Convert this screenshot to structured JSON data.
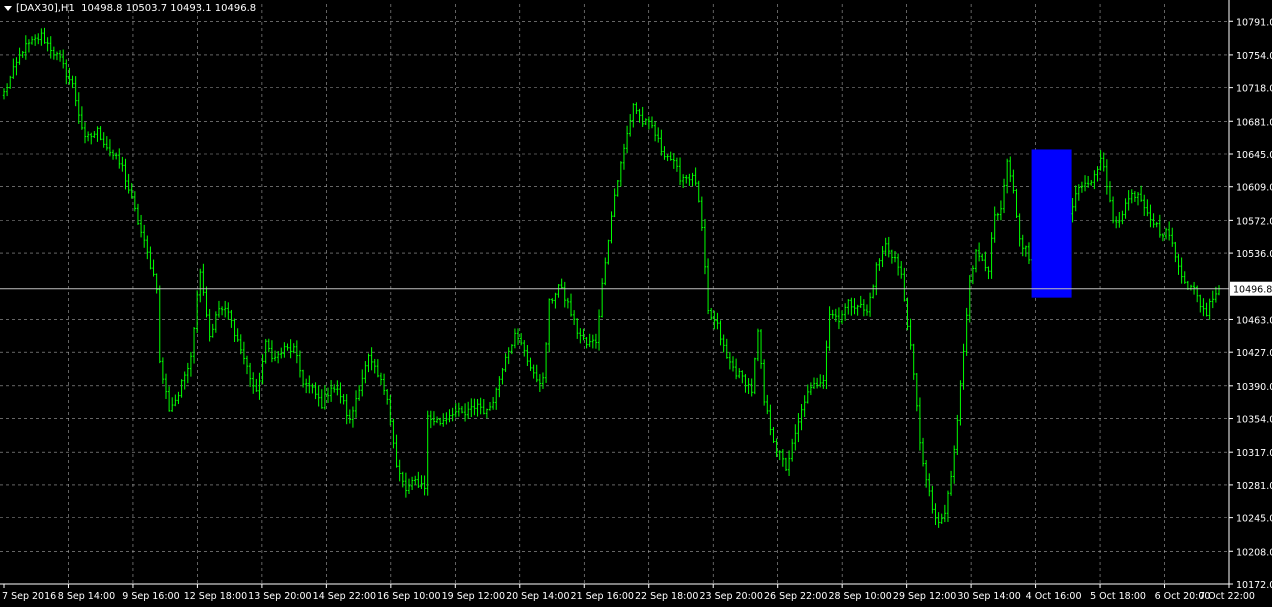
{
  "header": {
    "symbol_timeframe": "[DAX30],H1",
    "ohlc": "10498.8 10503.7 10493.1 10496.8"
  },
  "colors": {
    "background": "#000000",
    "candles": "#00ff00",
    "grid": "#c0c0c0",
    "axis_text": "#ffffff",
    "price_line": "#c0c0c0",
    "highlight": "#0000ff"
  },
  "chart_data": {
    "type": "candlestick",
    "symbol": "[DAX30]",
    "timeframe": "H1",
    "current_price": "10496.8",
    "ylim": [
      10172.0,
      10810.0
    ],
    "y_ticks": [
      "10791.0",
      "10754.0",
      "10718.0",
      "10681.0",
      "10645.0",
      "10609.0",
      "10572.0",
      "10536.0",
      "10463.0",
      "10427.0",
      "10390.0",
      "10354.0",
      "10317.0",
      "10281.0",
      "10245.0",
      "10208.0",
      "10172.0"
    ],
    "x_ticks": [
      "7 Sep 2016",
      "8 Sep 14:00",
      "9 Sep 16:00",
      "12 Sep 18:00",
      "13 Sep 20:00",
      "14 Sep 22:00",
      "16 Sep 10:00",
      "19 Sep 12:00",
      "20 Sep 14:00",
      "21 Sep 16:00",
      "22 Sep 18:00",
      "23 Sep 20:00",
      "26 Sep 22:00",
      "28 Sep 10:00",
      "29 Sep 12:00",
      "30 Sep 14:00",
      "4 Oct 16:00",
      "5 Oct 18:00",
      "6 Oct 20:00",
      "7 Oct 22:00"
    ],
    "grid": true,
    "highlight_zone": {
      "x_from": "4 Oct 16:00",
      "price_top": 10650,
      "price_bottom": 10487
    },
    "price_path": [
      [
        0,
        10712
      ],
      [
        6,
        10760
      ],
      [
        12,
        10775
      ],
      [
        18,
        10748
      ],
      [
        22,
        10720
      ],
      [
        26,
        10660
      ],
      [
        30,
        10670
      ],
      [
        34,
        10648
      ],
      [
        38,
        10630
      ],
      [
        42,
        10582
      ],
      [
        46,
        10535
      ],
      [
        49,
        10500
      ],
      [
        50,
        10415
      ],
      [
        53,
        10365
      ],
      [
        56,
        10380
      ],
      [
        60,
        10425
      ],
      [
        63,
        10520
      ],
      [
        66,
        10445
      ],
      [
        69,
        10475
      ],
      [
        72,
        10470
      ],
      [
        75,
        10440
      ],
      [
        78,
        10410
      ],
      [
        81,
        10380
      ],
      [
        84,
        10435
      ],
      [
        87,
        10420
      ],
      [
        90,
        10430
      ],
      [
        93,
        10430
      ],
      [
        96,
        10395
      ],
      [
        99,
        10385
      ],
      [
        102,
        10370
      ],
      [
        105,
        10390
      ],
      [
        108,
        10380
      ],
      [
        111,
        10350
      ],
      [
        114,
        10390
      ],
      [
        117,
        10420
      ],
      [
        120,
        10400
      ],
      [
        123,
        10380
      ],
      [
        126,
        10300
      ],
      [
        129,
        10275
      ],
      [
        132,
        10285
      ],
      [
        135,
        10280
      ],
      [
        136,
        10355
      ],
      [
        140,
        10350
      ],
      [
        144,
        10362
      ],
      [
        148,
        10358
      ],
      [
        152,
        10370
      ],
      [
        155,
        10360
      ],
      [
        158,
        10385
      ],
      [
        161,
        10425
      ],
      [
        164,
        10445
      ],
      [
        167,
        10430
      ],
      [
        170,
        10400
      ],
      [
        173,
        10395
      ],
      [
        175,
        10480
      ],
      [
        178,
        10500
      ],
      [
        181,
        10480
      ],
      [
        184,
        10450
      ],
      [
        187,
        10435
      ],
      [
        190,
        10440
      ],
      [
        193,
        10530
      ],
      [
        196,
        10600
      ],
      [
        199,
        10650
      ],
      [
        202,
        10700
      ],
      [
        205,
        10680
      ],
      [
        208,
        10675
      ],
      [
        211,
        10650
      ],
      [
        214,
        10640
      ],
      [
        217,
        10620
      ],
      [
        220,
        10620
      ],
      [
        222,
        10615
      ],
      [
        224,
        10562
      ],
      [
        226,
        10470
      ],
      [
        229,
        10455
      ],
      [
        232,
        10420
      ],
      [
        235,
        10405
      ],
      [
        238,
        10395
      ],
      [
        240,
        10385
      ],
      [
        242,
        10448
      ],
      [
        244,
        10372
      ],
      [
        246,
        10345
      ],
      [
        248,
        10320
      ],
      [
        251,
        10300
      ],
      [
        254,
        10335
      ],
      [
        257,
        10375
      ],
      [
        260,
        10390
      ],
      [
        263,
        10400
      ],
      [
        265,
        10470
      ],
      [
        268,
        10465
      ],
      [
        271,
        10480
      ],
      [
        274,
        10480
      ],
      [
        277,
        10470
      ],
      [
        280,
        10520
      ],
      [
        283,
        10545
      ],
      [
        286,
        10530
      ],
      [
        288,
        10510
      ],
      [
        290,
        10460
      ],
      [
        292,
        10400
      ],
      [
        294,
        10330
      ],
      [
        296,
        10285
      ],
      [
        298,
        10255
      ],
      [
        300,
        10235
      ],
      [
        302,
        10250
      ],
      [
        304,
        10290
      ],
      [
        306,
        10350
      ],
      [
        308,
        10430
      ],
      [
        310,
        10510
      ],
      [
        312,
        10535
      ],
      [
        314,
        10530
      ],
      [
        316,
        10520
      ],
      [
        318,
        10575
      ],
      [
        320,
        10580
      ],
      [
        322,
        10635
      ],
      [
        324,
        10600
      ],
      [
        326,
        10550
      ],
      [
        328,
        10540
      ],
      [
        330,
        10520
      ],
      [
        332,
        10530
      ],
      [
        334,
        10580
      ],
      [
        336,
        10580
      ],
      [
        338,
        10560
      ],
      [
        340,
        10545
      ],
      [
        342,
        10575
      ],
      [
        344,
        10600
      ],
      [
        347,
        10610
      ],
      [
        350,
        10620
      ],
      [
        352,
        10645
      ],
      [
        354,
        10610
      ],
      [
        356,
        10570
      ],
      [
        358,
        10575
      ],
      [
        360,
        10590
      ],
      [
        362,
        10600
      ],
      [
        364,
        10603
      ],
      [
        366,
        10590
      ],
      [
        369,
        10570
      ],
      [
        372,
        10555
      ],
      [
        374,
        10560
      ],
      [
        376,
        10530
      ],
      [
        378,
        10515
      ],
      [
        380,
        10500
      ],
      [
        382,
        10495
      ],
      [
        384,
        10480
      ],
      [
        386,
        10470
      ],
      [
        388,
        10490
      ],
      [
        390,
        10496.8
      ]
    ]
  }
}
